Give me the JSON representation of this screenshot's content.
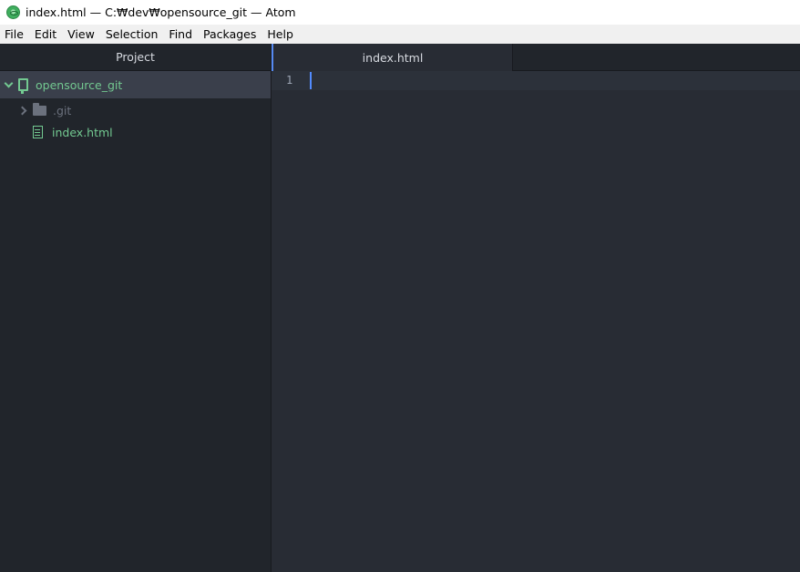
{
  "window": {
    "title": "index.html — C:₩dev₩opensource_git — Atom",
    "app_icon": "atom-icon"
  },
  "menu": {
    "items": [
      "File",
      "Edit",
      "View",
      "Selection",
      "Find",
      "Packages",
      "Help"
    ]
  },
  "sidebar": {
    "tab_label": "Project",
    "root": {
      "label": "opensource_git",
      "icon": "repo-icon",
      "expanded": true
    },
    "items": [
      {
        "label": ".git",
        "icon": "folder-icon",
        "type": "folder",
        "expanded": false
      },
      {
        "label": "index.html",
        "icon": "file-text-icon",
        "type": "file"
      }
    ]
  },
  "editor": {
    "tabs": [
      {
        "label": "index.html",
        "active": true
      }
    ],
    "line_numbers": [
      "1"
    ],
    "content": ""
  },
  "colors": {
    "accent": "#568af2",
    "vcs_added": "#73c991",
    "sidebar_bg": "#21252b",
    "editor_bg": "#282c34"
  }
}
